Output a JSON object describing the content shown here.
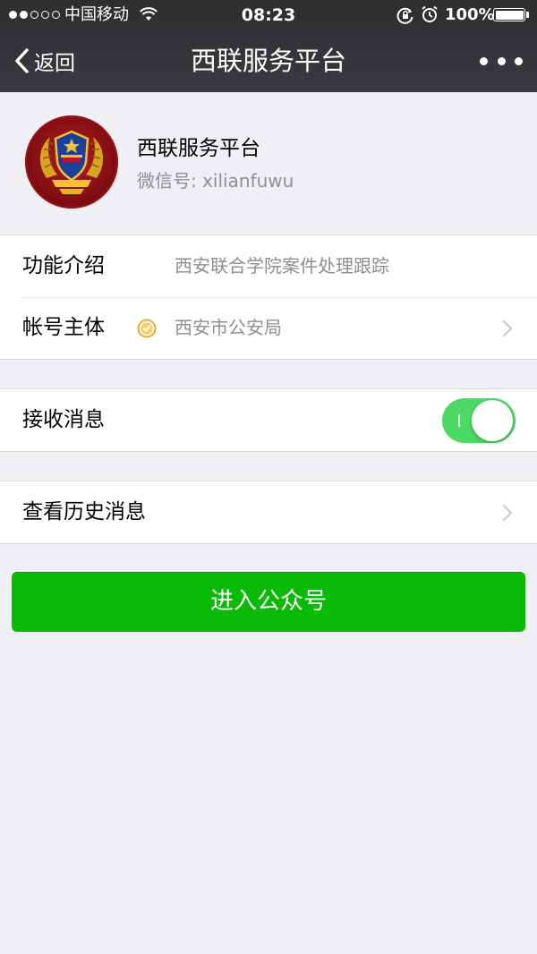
{
  "status_bar": {
    "carrier": "中国移动",
    "time": "08:23",
    "battery": "100%",
    "battery_level": 1.0,
    "signal_bars_filled": 2,
    "signal_bars_total": 5
  },
  "nav": {
    "back_label": "返回",
    "title": "西联服务平台"
  },
  "profile": {
    "name": "西联服务平台",
    "wechat_id_label": "微信号: ",
    "wechat_id": "xilianfuwu",
    "wechat_id_display": "微信号: xilianfuwu"
  },
  "info_rows": [
    {
      "label": "功能介绍",
      "value": "西安联合学院案件处理跟踪"
    },
    {
      "label": "帐号主体",
      "value": "西安市公安局",
      "verified": true
    }
  ],
  "receive_messages": {
    "label": "接收消息",
    "enabled": true
  },
  "history": {
    "label": "查看历史消息"
  },
  "enter_button": {
    "label": "进入公众号"
  },
  "colors": {
    "nav_bg": "#2e2e31",
    "page_bg": "#efeff4",
    "accent_green": "#09bb07",
    "toggle_green": "#4cd964",
    "verified_orange": "#f5a623",
    "secondary_text": "#8e8e93"
  }
}
